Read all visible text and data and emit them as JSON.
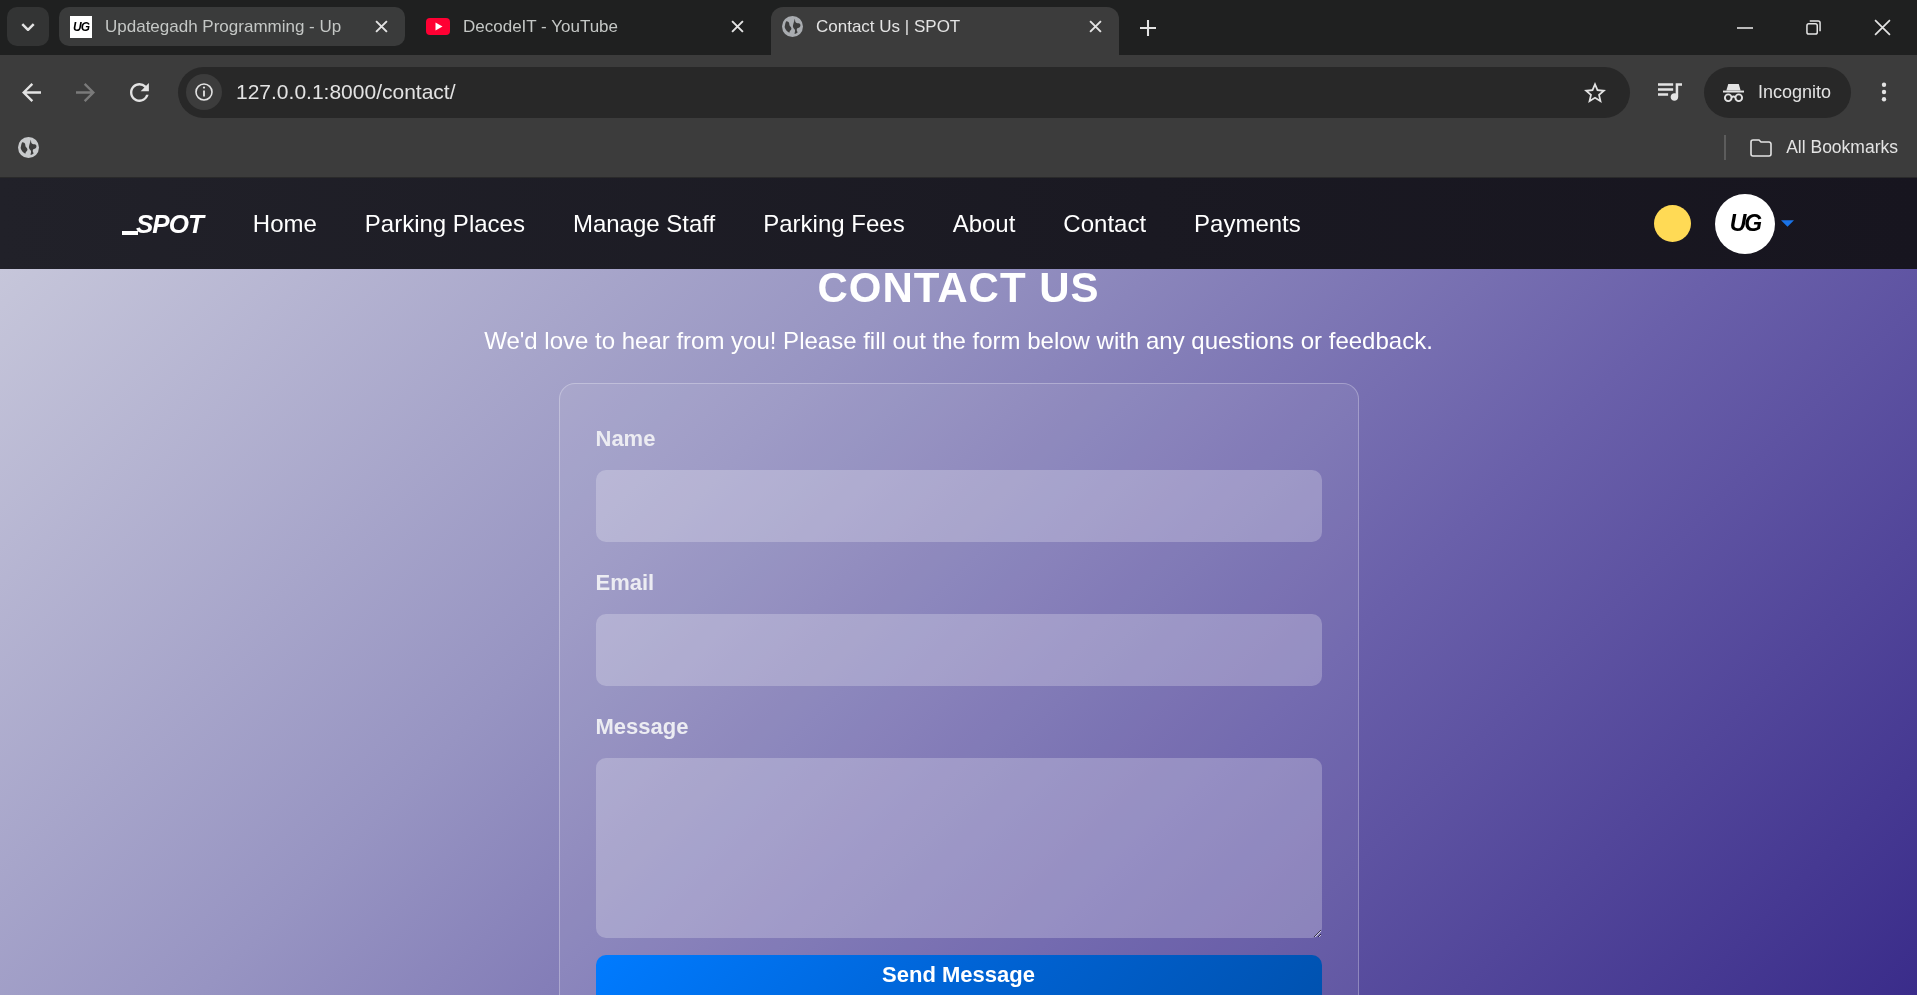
{
  "browser": {
    "tabs": [
      {
        "title": "Updategadh Programming - Up",
        "kind": "text-logo",
        "favicon_text": "UG",
        "selected": false,
        "hovered": true
      },
      {
        "title": "DecodeIT - YouTube",
        "kind": "video",
        "selected": false,
        "hovered": false
      },
      {
        "title": "Contact Us | SPOT",
        "kind": "globe",
        "selected": true,
        "hovered": false
      }
    ],
    "nav_buttons": [
      {
        "kind": "back",
        "disabled": false
      },
      {
        "kind": "forward",
        "disabled": true
      },
      {
        "kind": "reload",
        "disabled": false
      }
    ],
    "address_bar": {
      "url": "127.0.0.1:8000/contact/"
    },
    "profile_button": {
      "label": "Incognito"
    },
    "bookmarks_bar": {
      "all_bookmarks": "All Bookmarks"
    }
  },
  "site": {
    "logo": "SPOT",
    "nav_links": [
      "Home",
      "Parking Places",
      "Manage Staff",
      "Parking Fees",
      "About",
      "Contact",
      "Payments"
    ],
    "avatar_text": "UG"
  },
  "contact": {
    "title": "CONTACT US",
    "subtitle": "We'd love to hear from you! Please fill out the form below with any questions or feedback.",
    "fields": [
      {
        "label": "Name",
        "kind": "input"
      },
      {
        "label": "Email",
        "kind": "input"
      },
      {
        "label": "Message",
        "kind": "textarea"
      }
    ],
    "submit": "Send Message"
  }
}
